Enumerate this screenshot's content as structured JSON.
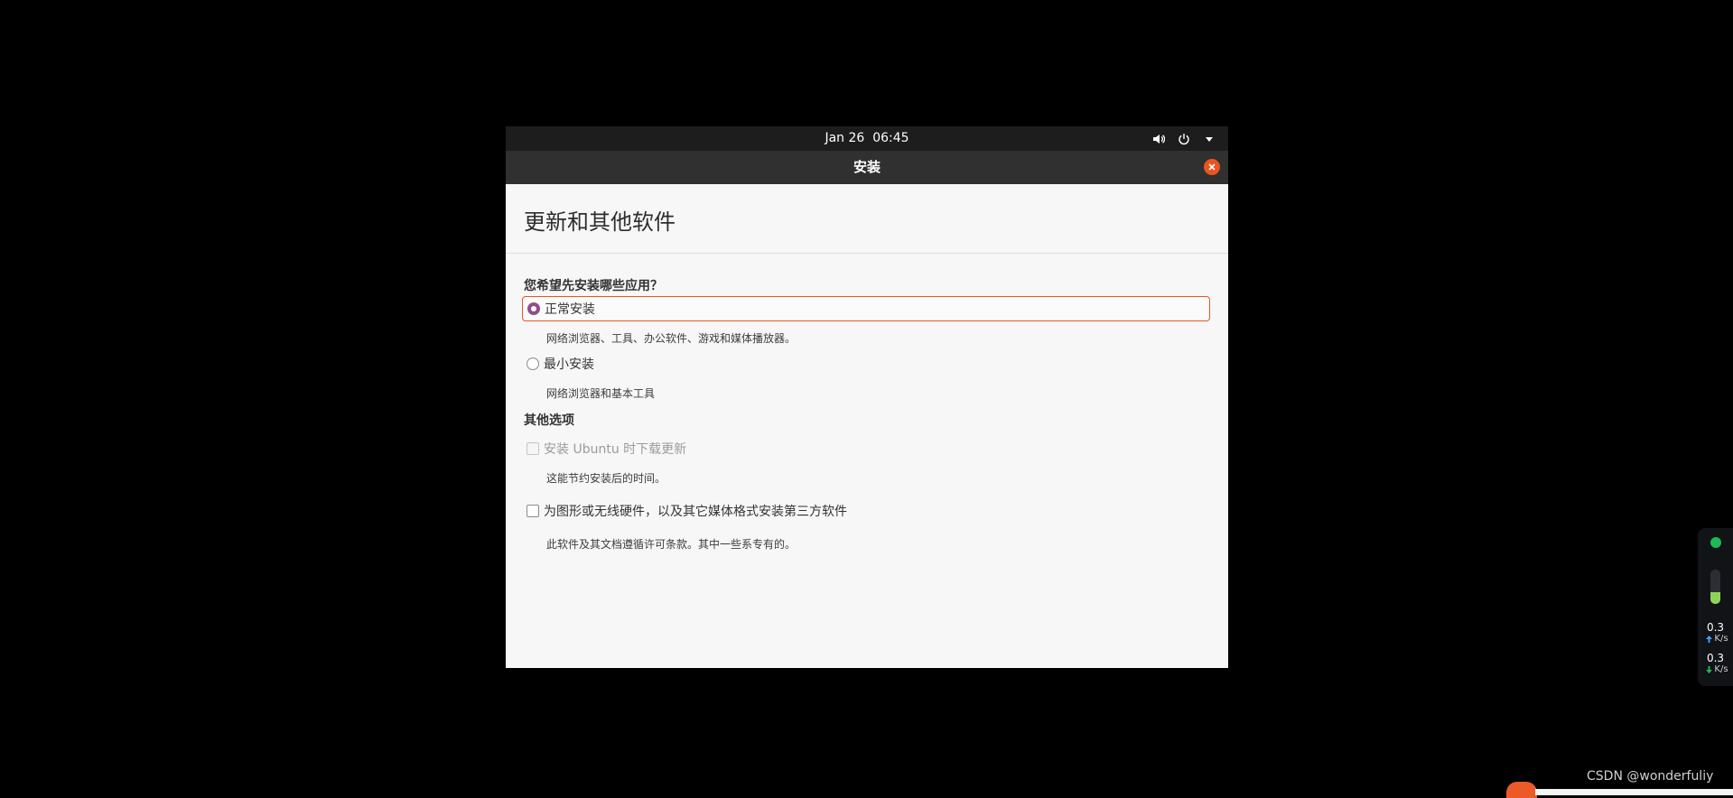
{
  "topbar": {
    "date": "Jan 26",
    "time": "06:45",
    "icons": [
      "volume-icon",
      "power-icon",
      "menu-arrow-icon"
    ]
  },
  "window": {
    "title": "安装",
    "close_icon": "close-icon"
  },
  "page": {
    "heading": "更新和其他软件",
    "question": "您希望先安装哪些应用？",
    "install_options": [
      {
        "label": "正常安装",
        "desc": "网络浏览器、工具、办公软件、游戏和媒体播放器。",
        "selected": true
      },
      {
        "label": "最小安装",
        "desc": "网络浏览器和基本工具",
        "selected": false
      }
    ],
    "other_section": "其他选项",
    "checkboxes": [
      {
        "label": "安装 Ubuntu 时下载更新",
        "desc": "这能节约安装后的时间。",
        "checked": false,
        "disabled": true
      },
      {
        "label": "为图形或无线硬件，以及其它媒体格式安装第三方软件",
        "desc": "此软件及其文档遵循许可条款。其中一些系专有的。",
        "checked": false,
        "disabled": false
      }
    ]
  },
  "net_widget": {
    "upload_value": "0.3",
    "upload_unit": "K/s",
    "download_value": "0.3",
    "download_unit": "K/s",
    "gauge_level": 0.35,
    "status_color": "#1db954"
  },
  "watermark": "CSDN @wonderfuliy",
  "colors": {
    "accent": "#e95420",
    "radio_selected": "#924d8b"
  }
}
